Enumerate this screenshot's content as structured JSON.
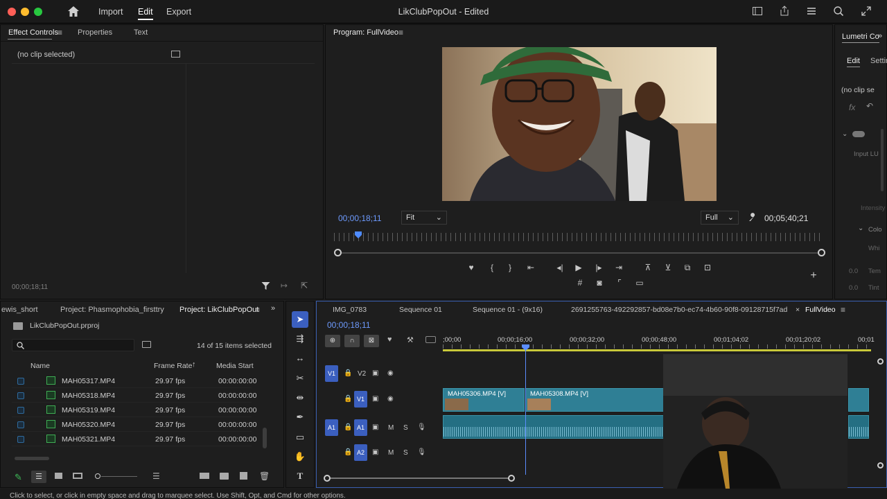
{
  "window": {
    "title": "LikClubPopOut - Edited",
    "menu": [
      "Import",
      "Edit",
      "Export"
    ],
    "traffic_colors": [
      "#ff5f57",
      "#febc2e",
      "#28c840"
    ]
  },
  "effect_controls": {
    "tabs": [
      "Effect Controls",
      "Properties",
      "Text"
    ],
    "no_clip": "(no clip selected)",
    "timecode": "00;00;18;11"
  },
  "program": {
    "title": "Program: FullVideo",
    "timecode": "00;00;18;11",
    "fit": "Fit",
    "quality": "Full",
    "duration": "00;05;40;21",
    "scrub_position": 0.05
  },
  "lumetri": {
    "title": "Lumetri Co",
    "tabs": [
      "Edit",
      "Settin"
    ],
    "no_clip": "(no clip se",
    "input": "Input LU",
    "intensity": "Intensity",
    "color": "Colo",
    "white": "Whi",
    "temp": "Tem",
    "tint": "Tint",
    "zero1": "0.0",
    "zero2": "0.0"
  },
  "project": {
    "tabs": [
      "ewis_short",
      "Project: Phasmophobia_firsttry",
      "Project: LikClubPopOut"
    ],
    "file": "LikClubPopOut.prproj",
    "selection": "14 of 15 items selected",
    "columns": [
      "Name",
      "Frame Rate",
      "Media Start"
    ],
    "rows": [
      {
        "name": "MAH05317.MP4",
        "fps": "29.97 fps",
        "start": "00:00:00:00"
      },
      {
        "name": "MAH05318.MP4",
        "fps": "29.97 fps",
        "start": "00:00:00:00"
      },
      {
        "name": "MAH05319.MP4",
        "fps": "29.97 fps",
        "start": "00:00:00:00"
      },
      {
        "name": "MAH05320.MP4",
        "fps": "29.97 fps",
        "start": "00:00:00:00"
      },
      {
        "name": "MAH05321.MP4",
        "fps": "29.97 fps",
        "start": "00:00:00:00"
      }
    ]
  },
  "timeline": {
    "tabs": [
      "IMG_0783",
      "Sequence 01",
      "Sequence 01 - (9x16)",
      "2691255763-492292857-bd08e7b0-ec74-4b60-90f8-09128715f7ad",
      "FullVideo"
    ],
    "timecode": "00;00;18;11",
    "ruler": [
      ";00;00",
      "00;00;16;00",
      "00;00;32;00",
      "00;00;48;00",
      "00;01;04;02",
      "00;01;20;02",
      "00;01"
    ],
    "tracks": {
      "v2": "V2",
      "v1": "V1",
      "a1": "A1",
      "a2": "A2",
      "src_v1": "V1",
      "src_a1": "A1",
      "m": "M",
      "s": "S"
    },
    "clips": [
      {
        "name": "MAH05306.MP4 [V]"
      },
      {
        "name": "MAH05308.MP4 [V]"
      }
    ]
  },
  "status": "Click to select, or click in empty space and drag to marquee select. Use Shift, Opt, and Cmd for other options.",
  "accent": "#3b5fbf",
  "clip_color": "#2f7f95"
}
